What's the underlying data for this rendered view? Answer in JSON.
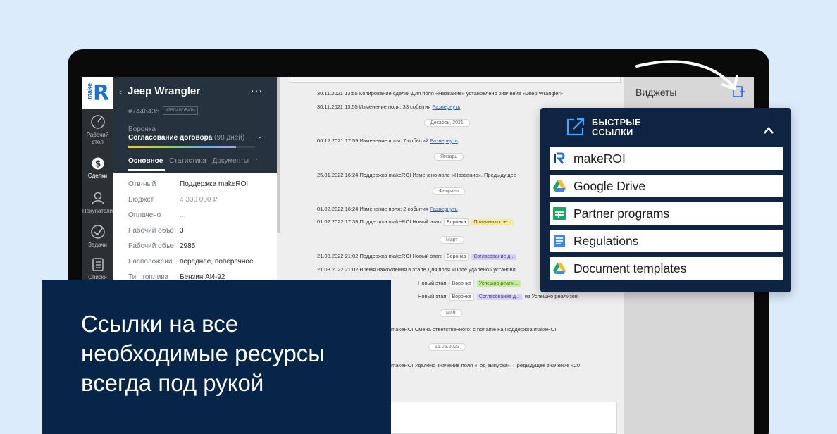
{
  "rail": {
    "logo_small": "make",
    "logo_big": "R",
    "items": [
      {
        "label": "Рабочий стол"
      },
      {
        "label": "Сделки"
      },
      {
        "label": "Покупатели"
      },
      {
        "label": "Задачи"
      },
      {
        "label": "Списки"
      }
    ]
  },
  "deal": {
    "title": "Jeep Wrangler",
    "more": "···",
    "id": "#7446435",
    "tag_button": "#ТЕГИРОВАТЬ",
    "funnel_label": "Воронка",
    "stage": "Согласование договора",
    "stage_days": "(98 дней)",
    "progress": 0.85,
    "tabs": [
      "Основное",
      "Статистика",
      "Документы"
    ],
    "tabs_more": "···",
    "fields": [
      {
        "key": "Отв-ный",
        "value": "Поддержка makeROI"
      },
      {
        "key": "Бюджет",
        "value": "4 300 000 ₽"
      },
      {
        "key": "Оплачено",
        "value": "..."
      },
      {
        "key": "Рабочий объе",
        "value": "3"
      },
      {
        "key": "Рабочий объе",
        "value": "2985"
      },
      {
        "key": "Расположени",
        "value": "переднее, поперечное"
      },
      {
        "key": "Тип топлива",
        "value": "Бензин АИ-92"
      }
    ]
  },
  "feed": {
    "events": [
      {
        "text": "30.11.2021 13:55 Копирование сделки Для поля «Название» установлено значение «Jeep Wrangler»"
      },
      {
        "text": "30.11.2021 13:55 Изменение поля: 33 события",
        "link": "Развернуть"
      },
      {
        "text": "06.12.2021 17:59 Изменение поля: 7 событий",
        "link": "Развернуть"
      },
      {
        "text": "25.01.2022 16:24 Поддержка makeROI Изменено поле «Название». Предыдущее"
      },
      {
        "text": "01.02.2022 16:24 Изменение поля: 2 события",
        "link": "Развернуть"
      },
      {
        "text": "01.02.2022 17:33 Поддержка makeROI Новый этап:",
        "chip1": "Воронка",
        "chip2": "Принимают ре..."
      },
      {
        "text": "21.03.2022 21:02 Поддержка makeROI Новый этап:",
        "chip1": "Воронка",
        "chip2": "Согласование д..."
      },
      {
        "text": "21.03.2022 21:02 Время нахождения в этапе Для поля «Поле удалено» установл"
      },
      {
        "text": "Новый этап:",
        "chip1": "Воронка",
        "chip2": "Успешно реали..."
      },
      {
        "text": "Новый этап:",
        "chip1": "Воронка",
        "chip2": "Согласование д...",
        "tail": "из Успешно реализов"
      },
      {
        "text": "makeROI Смена ответственного: с noname на Поддержка makeROI"
      },
      {
        "text": "makeROI Удалено значение поля «Год выпуска». Предыдущее значение «20"
      }
    ],
    "separators": [
      "Декабрь, 2021",
      "Январь",
      "Февраль",
      "Март",
      "Май",
      "15.06.2022"
    ]
  },
  "widgets": {
    "title": "Виджеты"
  },
  "quick_links": {
    "title": "БЫСТРЫЕ ССЫЛКИ",
    "items": [
      {
        "label": "makeROI",
        "icon": "makeroi-logo-icon"
      },
      {
        "label": "Google Drive",
        "icon": "google-drive-icon"
      },
      {
        "label": "Partner programs",
        "icon": "google-sheets-icon"
      },
      {
        "label": "Regulations",
        "icon": "google-docs-icon"
      },
      {
        "label": "Document templates",
        "icon": "google-drive-icon"
      }
    ]
  },
  "caption": {
    "text": "Ссылки на все необходимые ресурсы всегда под рукой"
  },
  "colors": {
    "background": "#dcebfb",
    "popup": "#0f2442",
    "caption": "#062548",
    "panel": "#26323d"
  }
}
